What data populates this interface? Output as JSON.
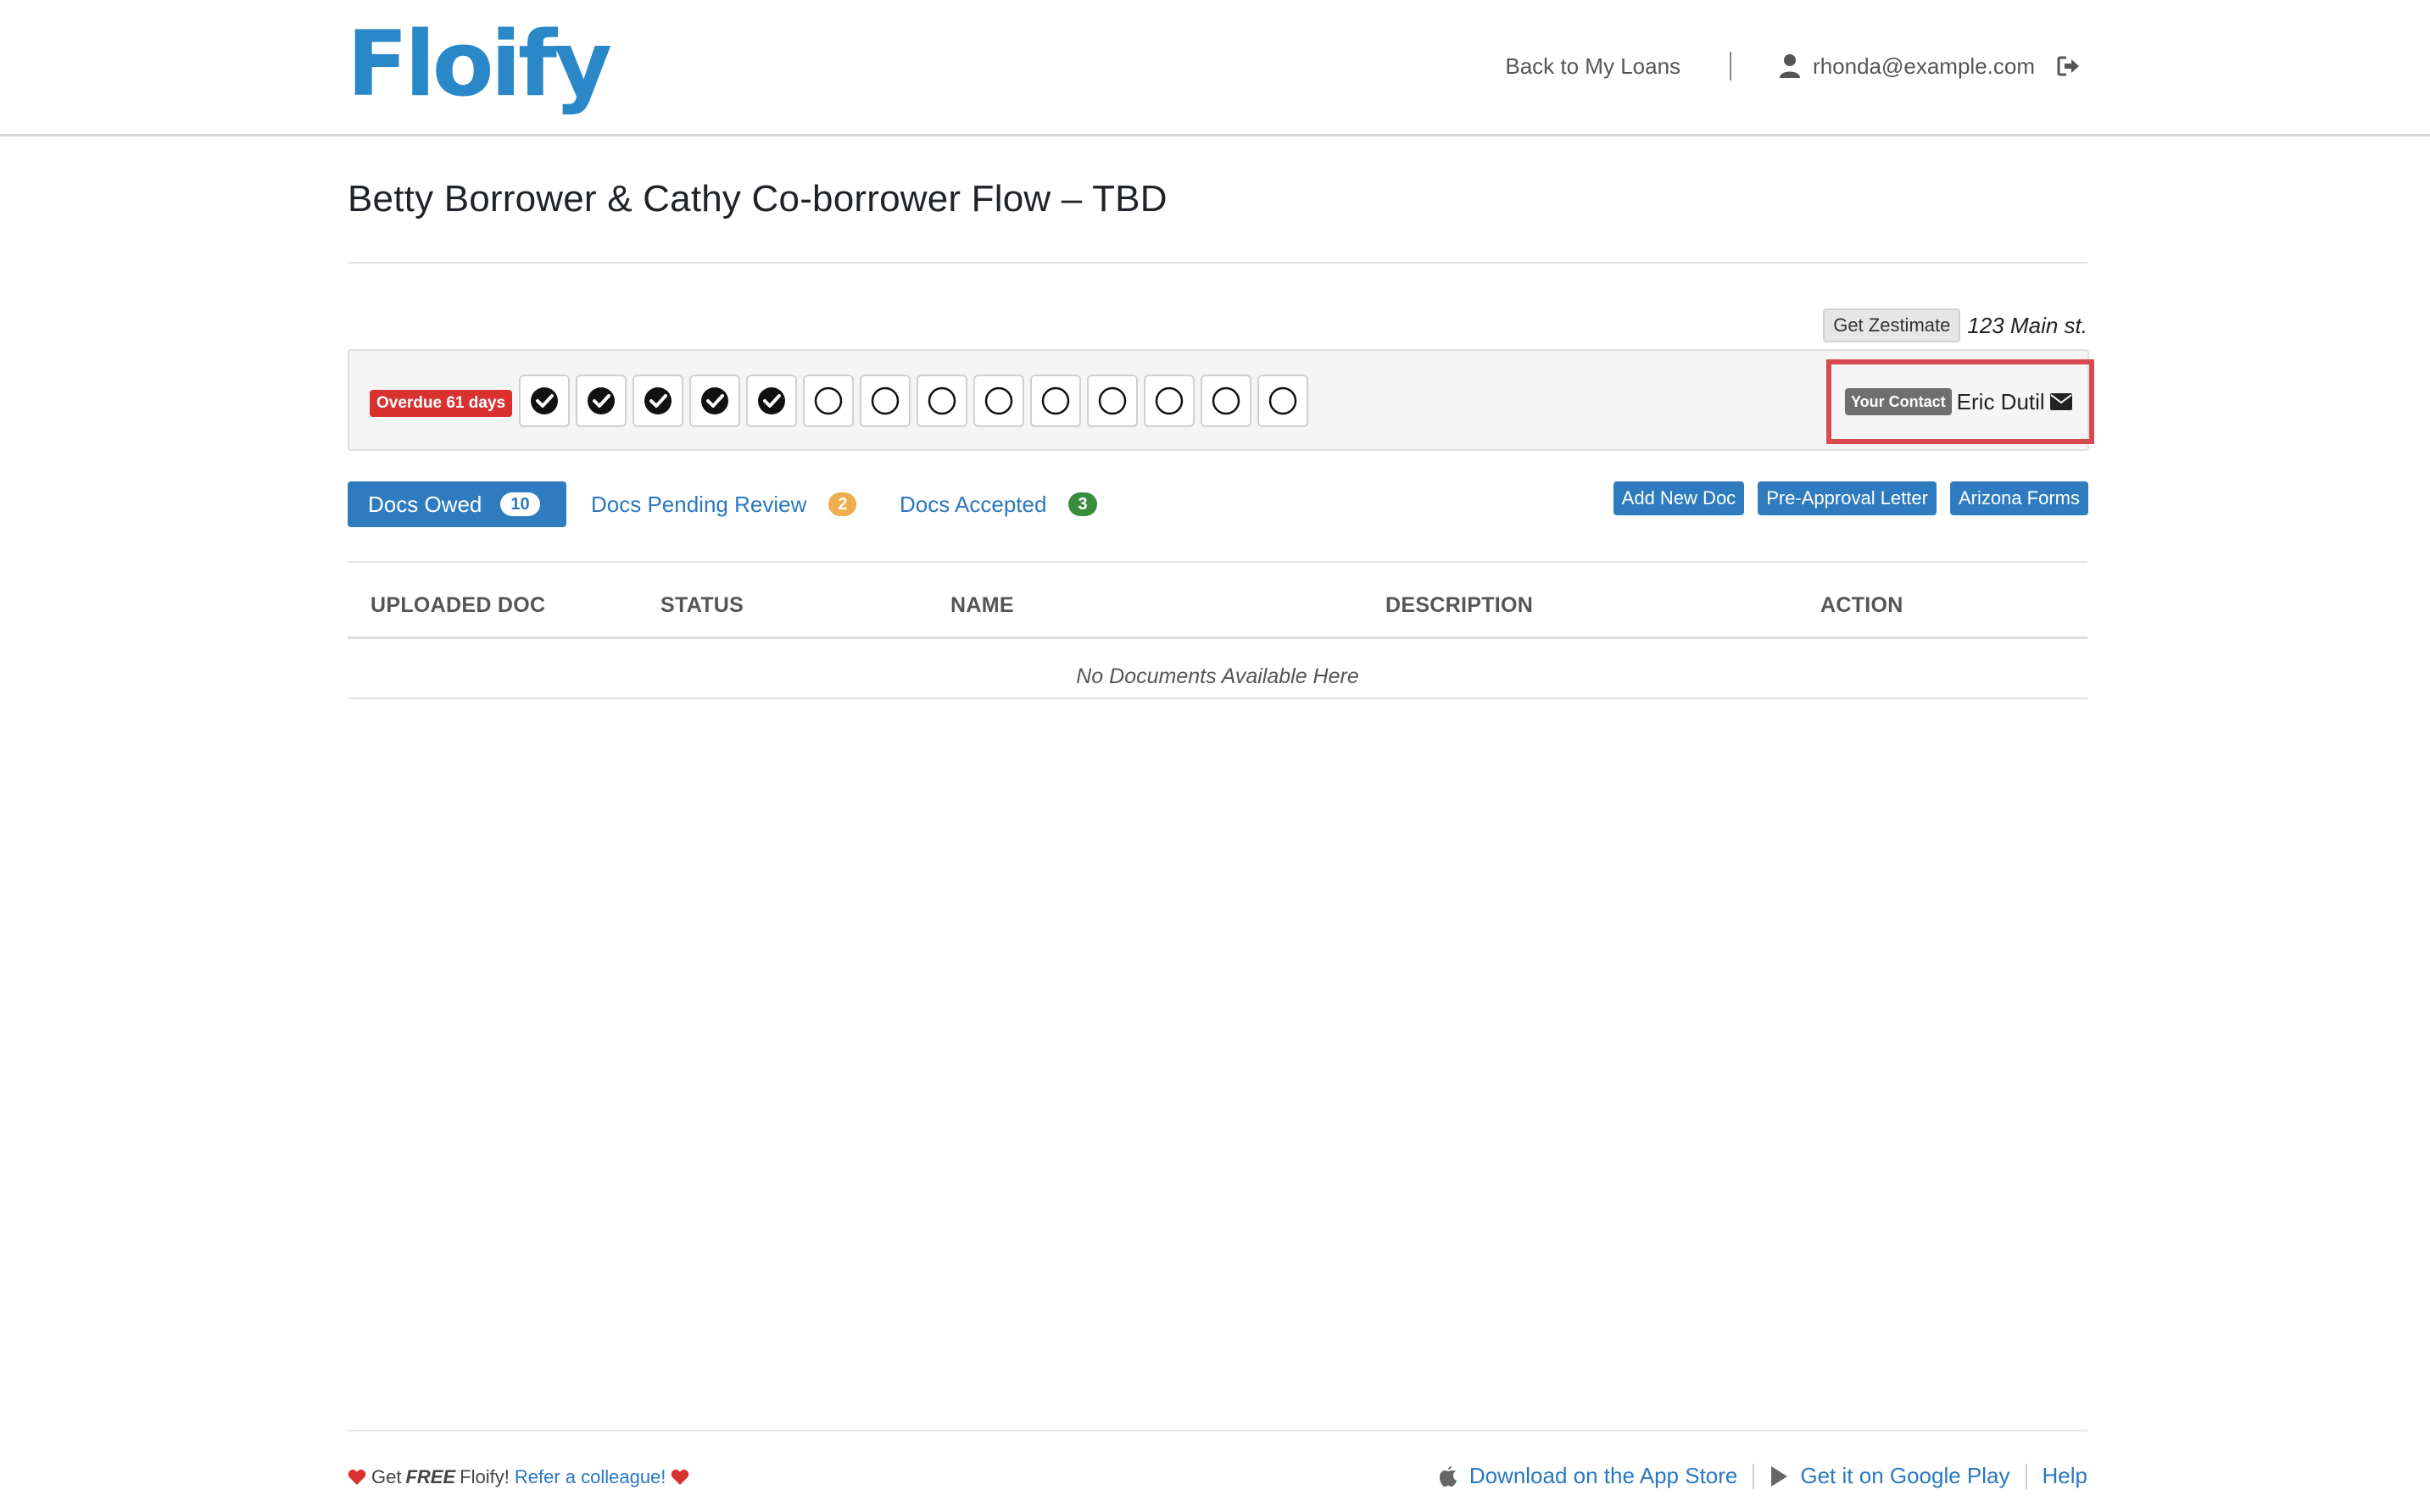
{
  "header": {
    "logo_text": "Floify",
    "back_link": "Back to My Loans",
    "user_email": "rhonda@example.com"
  },
  "page": {
    "title": "Betty Borrower & Cathy Co-borrower Flow – TBD"
  },
  "property": {
    "zestimate_button": "Get Zestimate",
    "address": "123 Main st."
  },
  "progress": {
    "overdue_label": "Overdue 61 days",
    "steps_completed": 5,
    "steps_total": 14
  },
  "contact": {
    "label": "Your Contact",
    "name": "Eric Dutil"
  },
  "tabs": [
    {
      "label": "Docs Owed",
      "count": "10"
    },
    {
      "label": "Docs Pending Review",
      "count": "2"
    },
    {
      "label": "Docs Accepted",
      "count": "3"
    }
  ],
  "actions": {
    "add_doc": "Add New Doc",
    "pre_approval": "Pre-Approval Letter",
    "arizona_forms": "Arizona Forms"
  },
  "table": {
    "columns": [
      "UPLOADED DOC",
      "STATUS",
      "NAME",
      "DESCRIPTION",
      "ACTION"
    ],
    "empty_message": "No Documents Available Here"
  },
  "footer": {
    "get": "Get",
    "free": "FREE",
    "floify": "Floify!",
    "refer": "Refer a colleague!",
    "app_store": "Download on the App Store",
    "google_play": "Get it on Google Play",
    "help": "Help"
  },
  "colors": {
    "brand_blue": "#2a88c8",
    "button_blue": "#2e7cbf",
    "overdue_red": "#d9312f",
    "highlight_red": "#d84a52",
    "badge_orange": "#f0ad4e",
    "badge_green": "#3c8c3f"
  }
}
